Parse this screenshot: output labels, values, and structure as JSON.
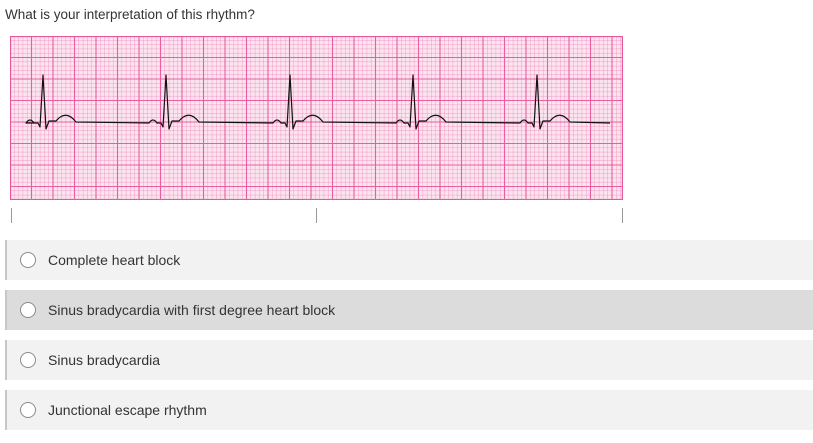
{
  "question": {
    "text": "What is your interpretation of this rhythm?"
  },
  "ecg_strip": {
    "grid_color": "#e8579b",
    "background_color": "#fbe4ef",
    "trace_color": "#111111",
    "beat_count": 5
  },
  "answer_options": [
    {
      "label": "Complete heart block",
      "selected": false
    },
    {
      "label": "Sinus bradycardia with first degree heart block",
      "selected": false
    },
    {
      "label": "Sinus bradycardia",
      "selected": false
    },
    {
      "label": "Junctional escape rhythm",
      "selected": false
    }
  ],
  "colors": {
    "option_bg": "#f2f2f2",
    "option_hover_bg": "#dcdcdc",
    "option_border": "#c7c7c7"
  }
}
